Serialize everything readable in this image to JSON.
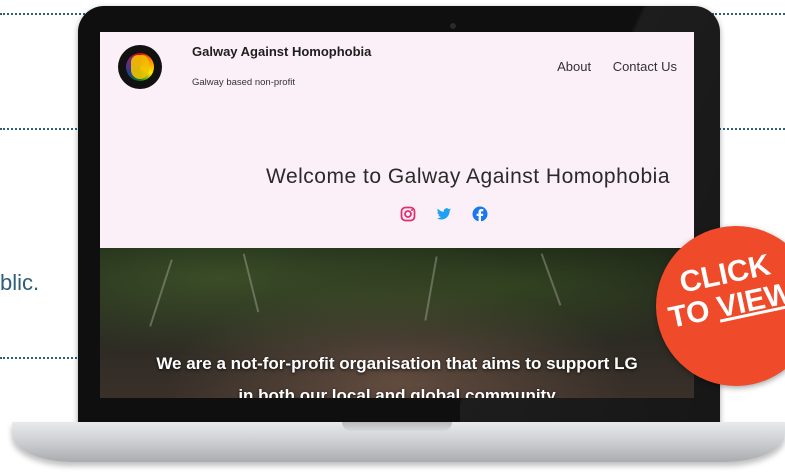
{
  "background": {
    "side_text": "blic."
  },
  "site": {
    "name": "Galway Against Homophobia",
    "tagline": "Galway based non-profit",
    "nav": [
      "About",
      "Contact Us"
    ],
    "welcome": "Welcome to Galway Against Homophobia",
    "socials": [
      {
        "icon": "instagram-icon",
        "color": "#e1306c"
      },
      {
        "icon": "twitter-icon",
        "color": "#1da1f2"
      },
      {
        "icon": "facebook-icon",
        "color": "#1877f2"
      }
    ],
    "hero_line1": "We are a not-for-profit organisation that aims to support LG",
    "hero_line2": "in both our local and global community"
  },
  "badge": {
    "line1": "CLICK",
    "line2_pre": "TO ",
    "line2_underlined": "VIEW",
    "color": "#ef4a2a"
  },
  "colors": {
    "site_background": "#fbf0f8",
    "accent": "#2e5f78"
  }
}
